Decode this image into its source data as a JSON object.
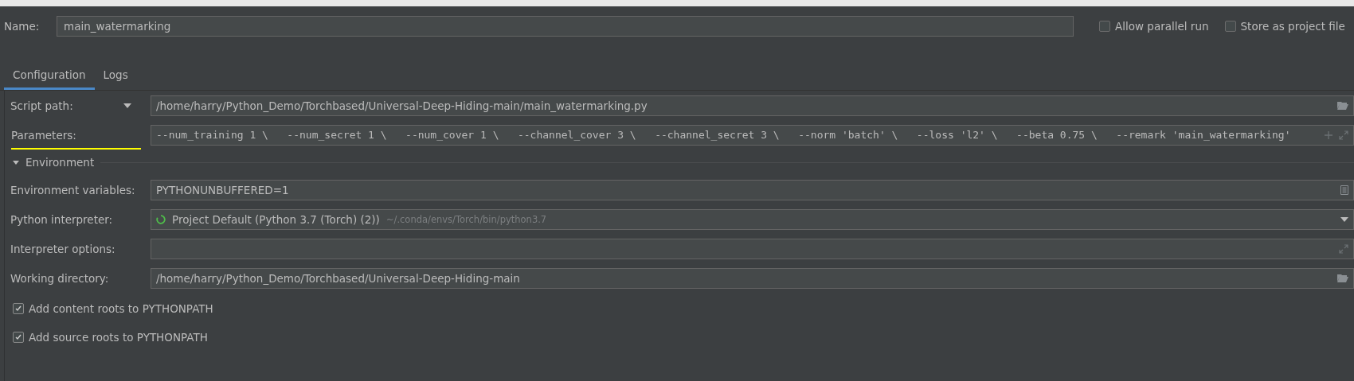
{
  "name_field": {
    "label": "Name:",
    "value": "main_watermarking"
  },
  "options": [
    {
      "label": "Allow parallel run",
      "checked": false
    },
    {
      "label": "Store as project file",
      "checked": false
    }
  ],
  "tabs": [
    {
      "label": "Configuration",
      "selected": true
    },
    {
      "label": "Logs",
      "selected": false
    }
  ],
  "script_row": {
    "label": "Script path:",
    "value": "/home/harry/Python_Demo/Torchbased/Universal-Deep-Hiding-main/main_watermarking.py"
  },
  "parameters_row": {
    "label": "Parameters:",
    "value": "--num_training 1 \\   --num_secret 1 \\   --num_cover 1 \\   --channel_cover 3 \\   --channel_secret 3 \\   --norm 'batch' \\   --loss 'l2' \\   --beta 0.75 \\   --remark 'main_watermarking'"
  },
  "environment": {
    "title": "Environment",
    "expanded": true,
    "fields": [
      {
        "kind": "text",
        "label": "Environment variables:",
        "value": "PYTHONUNBUFFERED=1"
      },
      {
        "kind": "interpreter",
        "label": "Python interpreter:",
        "value": "Project Default (Python 3.7 (Torch) (2))",
        "hint": "~/.conda/envs/Torch/bin/python3.7"
      },
      {
        "kind": "expand",
        "label": "Interpreter options:"
      },
      {
        "kind": "folder",
        "label": "Working directory:",
        "value": "/home/harry/Python_Demo/Torchbased/Universal-Deep-Hiding-main"
      }
    ]
  },
  "path_options": [
    {
      "label": "Add content roots to PYTHONPATH",
      "checked": true
    },
    {
      "label": "Add source roots to PYTHONPATH",
      "checked": true
    }
  ]
}
